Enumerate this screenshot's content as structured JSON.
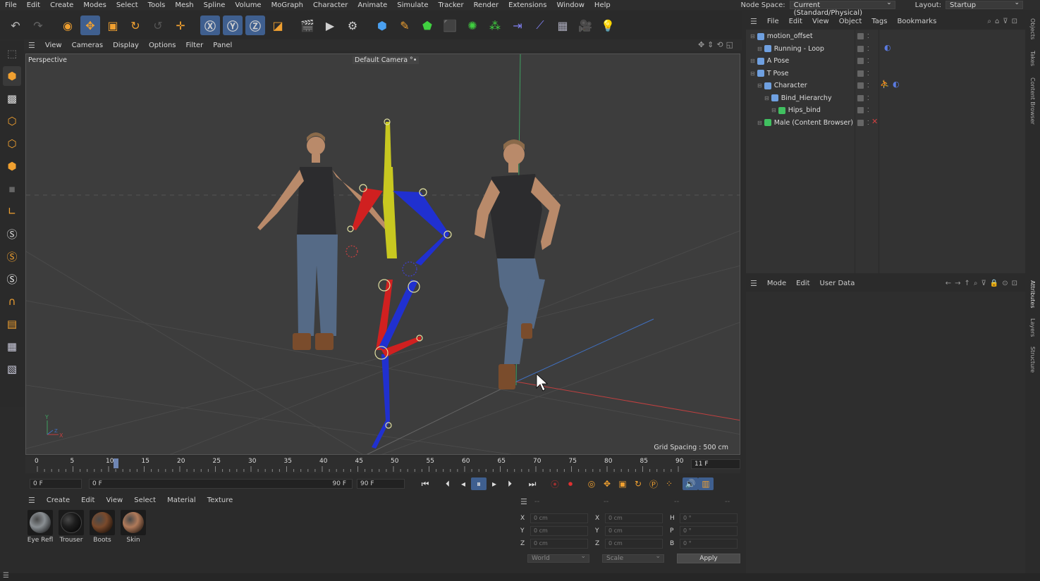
{
  "menubar": [
    "File",
    "Edit",
    "Create",
    "Modes",
    "Select",
    "Tools",
    "Mesh",
    "Spline",
    "Volume",
    "MoGraph",
    "Character",
    "Animate",
    "Simulate",
    "Tracker",
    "Render",
    "Extensions",
    "Window",
    "Help"
  ],
  "nodespace": {
    "label": "Node Space:",
    "value": "Current (Standard/Physical)"
  },
  "layout": {
    "label": "Layout:",
    "value": "Startup"
  },
  "viewport": {
    "menu": [
      "View",
      "Cameras",
      "Display",
      "Options",
      "Filter",
      "Panel"
    ],
    "view_name": "Perspective",
    "camera": "Default Camera",
    "camera_icon": "°•",
    "grid_spacing": "Grid Spacing : 500 cm",
    "axis_labels": {
      "y": "Y",
      "x": "X",
      "z": "Z"
    }
  },
  "timeline": {
    "ticks": [
      "0",
      "5",
      "10",
      "15",
      "20",
      "25",
      "30",
      "35",
      "40",
      "45",
      "50",
      "55",
      "60",
      "65",
      "70",
      "75",
      "80",
      "85",
      "90"
    ],
    "current_frame_label": "11 F",
    "current_frame": 11,
    "max_frame": 90
  },
  "transport": {
    "start": "0 F",
    "range_start": "0 F",
    "range_end": "90 F",
    "end": "90 F"
  },
  "materials": {
    "menu": [
      "Create",
      "Edit",
      "View",
      "Select",
      "Material",
      "Texture"
    ],
    "items": [
      {
        "label": "Eye Refl",
        "color": "#8a8f93"
      },
      {
        "label": "Trouser",
        "color": "#1d1d1d"
      },
      {
        "label": "Boots",
        "color": "#7a4a2c"
      },
      {
        "label": "Skin",
        "color": "#b07a5a"
      }
    ]
  },
  "coords": {
    "header_a": "--",
    "header_b": "--",
    "header_c": "--",
    "header_d": "--",
    "rows": [
      {
        "a": "X",
        "av": "0 cm",
        "b": "X",
        "bv": "0 cm",
        "c": "H",
        "cv": "0 °"
      },
      {
        "a": "Y",
        "av": "0 cm",
        "b": "Y",
        "bv": "0 cm",
        "c": "P",
        "cv": "0 °"
      },
      {
        "a": "Z",
        "av": "0 cm",
        "b": "Z",
        "bv": "0 cm",
        "c": "B",
        "cv": "0 °"
      }
    ],
    "world": "World",
    "scale": "Scale",
    "apply": "Apply"
  },
  "objects": {
    "menu": [
      "File",
      "Edit",
      "View",
      "Object",
      "Tags",
      "Bookmarks"
    ],
    "items": [
      {
        "label": "motion_offset",
        "indent": 0
      },
      {
        "label": "Running - Loop",
        "indent": 1
      },
      {
        "label": "A Pose",
        "indent": 0
      },
      {
        "label": "T Pose",
        "indent": 0
      },
      {
        "label": "Character",
        "indent": 1
      },
      {
        "label": "Bind_Hierarchy",
        "indent": 2
      },
      {
        "label": "Hips_bind",
        "indent": 3
      },
      {
        "label": "Male (Content Browser)",
        "indent": 1
      }
    ]
  },
  "attributes": {
    "menu": [
      "Mode",
      "Edit",
      "User Data"
    ]
  },
  "side_tabs": [
    "Objects",
    "Takes",
    "Content Browser",
    "Attributes",
    "Layers",
    "Structure"
  ]
}
